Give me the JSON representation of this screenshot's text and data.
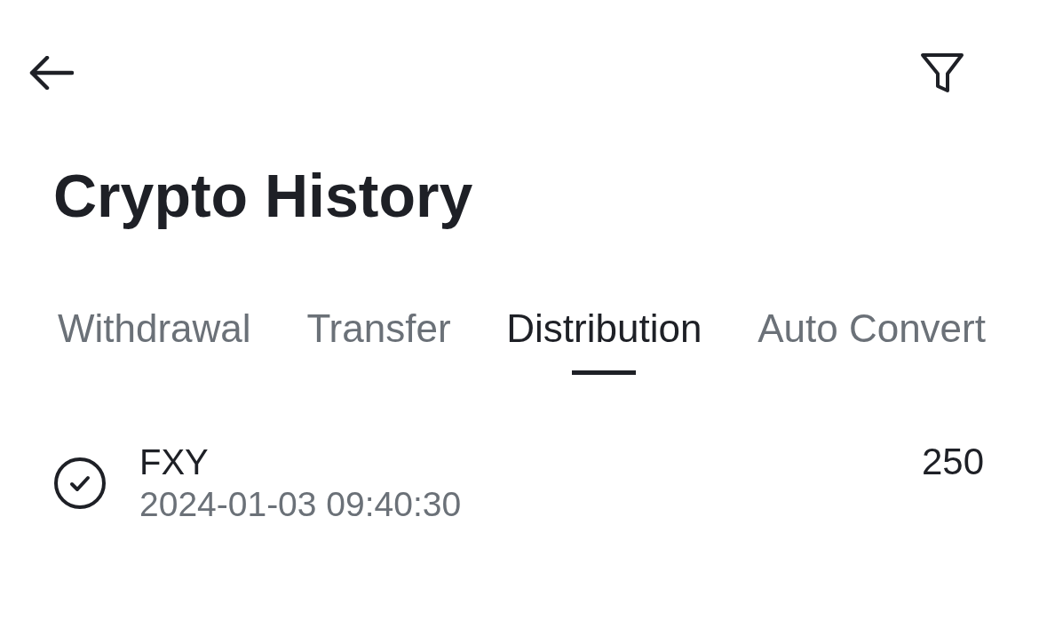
{
  "header": {
    "title": "Crypto History"
  },
  "tabs": [
    {
      "label": "Withdrawal",
      "selected": false
    },
    {
      "label": "Transfer",
      "selected": false
    },
    {
      "label": "Distribution",
      "selected": true
    },
    {
      "label": "Auto Convert",
      "selected": false
    }
  ],
  "records": [
    {
      "asset": "FXY",
      "time": "2024-01-03 09:40:30",
      "amount": "250",
      "completed": true
    }
  ]
}
